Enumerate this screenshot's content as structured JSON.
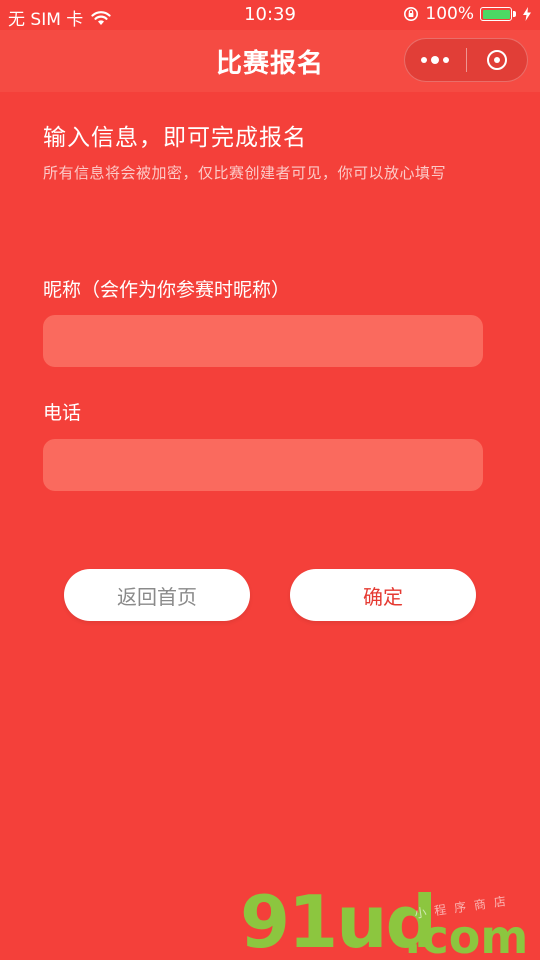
{
  "status_bar": {
    "carrier": "无 SIM 卡",
    "wifi_icon": "wifi-icon",
    "time": "10:39",
    "orientation_lock_icon": "rotation-lock-icon",
    "battery_percent": "100%",
    "battery_level": 1.0,
    "charging_icon": "bolt-icon"
  },
  "nav": {
    "title": "比赛报名",
    "more_icon": "more-dots-icon",
    "close_icon": "target-circle-icon"
  },
  "intro": {
    "headline": "输入信息，即可完成报名",
    "subline": "所有信息将会被加密，仅比赛创建者可见，你可以放心填写"
  },
  "form": {
    "nickname_label": "昵称（会作为你参赛时昵称）",
    "nickname_value": "",
    "phone_label": "电话",
    "phone_value": ""
  },
  "buttons": {
    "home_label": "返回首页",
    "confirm_label": "确定"
  },
  "watermark": {
    "brand": "91ud",
    "domain": ".com",
    "tagline": "小程序商店"
  },
  "colors": {
    "background": "#f4403a",
    "input_fill": "#fa6a5e",
    "confirm_text": "#e53a32",
    "home_text": "#8a8a8a",
    "battery_fill": "#4cd964",
    "watermark_green": "#8cc63f"
  }
}
